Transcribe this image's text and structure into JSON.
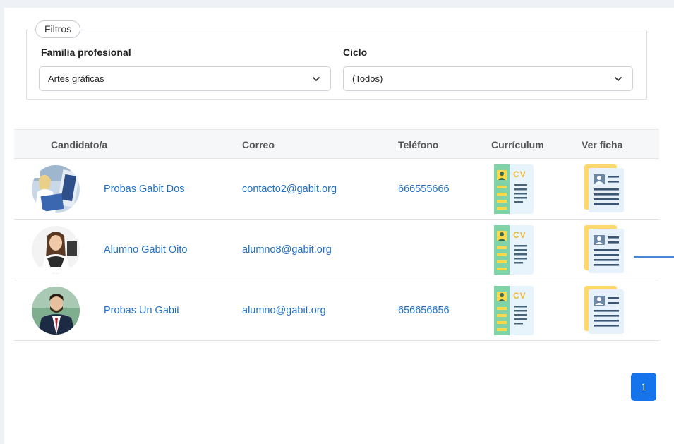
{
  "filters": {
    "legend": "Filtros",
    "familia": {
      "label": "Familia profesional",
      "value": "Artes gráficas"
    },
    "ciclo": {
      "label": "Ciclo",
      "value": "(Todos)"
    }
  },
  "table": {
    "headers": {
      "candidato": "Candidato/a",
      "correo": "Correo",
      "telefono": "Teléfono",
      "curriculum": "Currículum",
      "ficha": "Ver ficha"
    },
    "rows": [
      {
        "name": "Probas Gabit Dos",
        "email": "contacto2@gabit.org",
        "phone": "666555666"
      },
      {
        "name": "Alumno Gabit Oito",
        "email": "alumno8@gabit.org",
        "phone": ""
      },
      {
        "name": "Probas Un Gabit",
        "email": "alumno@gabit.org",
        "phone": "656656656"
      }
    ],
    "cv_text": "CV"
  },
  "pagination": {
    "current": "1"
  },
  "colors": {
    "link": "#1f6fc7",
    "accent": "#1574ec",
    "cv_green": "#7fd3a6",
    "cv_yellow": "#ffd84a",
    "card_yellow": "#ffd86b"
  },
  "icons": {
    "dropdown": "chevron-down-icon",
    "cv": "cv-document-icon",
    "ficha": "profile-card-icon"
  }
}
